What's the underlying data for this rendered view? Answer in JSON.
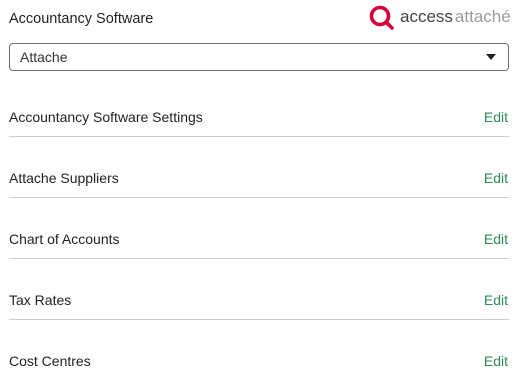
{
  "header": {
    "title": "Accountancy Software",
    "logo": {
      "text_primary": "access",
      "text_secondary": "attaché",
      "mark_color": "#d6003b"
    }
  },
  "software_select": {
    "value": "Attache",
    "icon": "caret-down-icon"
  },
  "sections": [
    {
      "label": "Accountancy Software Settings",
      "action": "Edit"
    },
    {
      "label": "Attache Suppliers",
      "action": "Edit"
    },
    {
      "label": "Chart of Accounts",
      "action": "Edit"
    },
    {
      "label": "Tax Rates",
      "action": "Edit"
    },
    {
      "label": "Cost Centres",
      "action": "Edit"
    }
  ],
  "colors": {
    "edit_link": "#2e8b57",
    "divider": "#cfcfcf"
  }
}
